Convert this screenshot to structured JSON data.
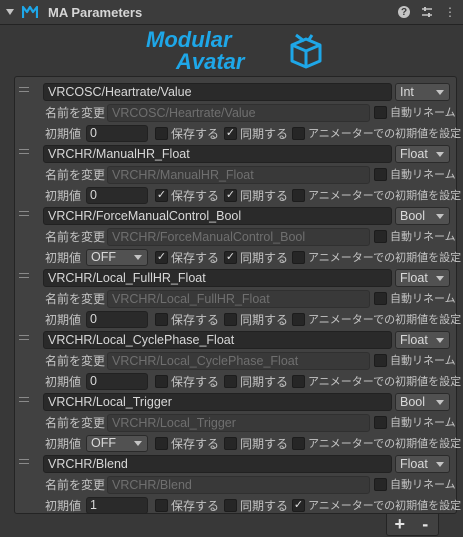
{
  "window": {
    "title": "MA Parameters"
  },
  "labels": {
    "rename": "名前を変更",
    "auto_rename": "自動リネーム",
    "initial_value": "初期値",
    "saved": "保存する",
    "synced": "同期する",
    "animator_default": "アニメーターでの初期値を設定"
  },
  "params": [
    {
      "name": "VRCOSC/Heartrate/Value",
      "type": "Int",
      "rename_placeholder": "VRCOSC/Heartrate/Value",
      "auto_rename": false,
      "default_value": "0",
      "default_is_dropdown": false,
      "saved": false,
      "synced": true,
      "animator_default": false
    },
    {
      "name": "VRCHR/ManualHR_Float",
      "type": "Float",
      "rename_placeholder": "VRCHR/ManualHR_Float",
      "auto_rename": false,
      "default_value": "0",
      "default_is_dropdown": false,
      "saved": true,
      "synced": true,
      "animator_default": false
    },
    {
      "name": "VRCHR/ForceManualControl_Bool",
      "type": "Bool",
      "rename_placeholder": "VRCHR/ForceManualControl_Bool",
      "auto_rename": false,
      "default_value": "OFF",
      "default_is_dropdown": true,
      "saved": true,
      "synced": true,
      "animator_default": false
    },
    {
      "name": "VRCHR/Local_FullHR_Float",
      "type": "Float",
      "rename_placeholder": "VRCHR/Local_FullHR_Float",
      "auto_rename": false,
      "default_value": "0",
      "default_is_dropdown": false,
      "saved": false,
      "synced": false,
      "animator_default": false
    },
    {
      "name": "VRCHR/Local_CyclePhase_Float",
      "type": "Float",
      "rename_placeholder": "VRCHR/Local_CyclePhase_Float",
      "auto_rename": false,
      "default_value": "0",
      "default_is_dropdown": false,
      "saved": false,
      "synced": false,
      "animator_default": false
    },
    {
      "name": "VRCHR/Local_Trigger",
      "type": "Bool",
      "rename_placeholder": "VRCHR/Local_Trigger",
      "auto_rename": false,
      "default_value": "OFF",
      "default_is_dropdown": true,
      "saved": false,
      "synced": false,
      "animator_default": false
    },
    {
      "name": "VRCHR/Blend",
      "type": "Float",
      "rename_placeholder": "VRCHR/Blend",
      "auto_rename": false,
      "default_value": "1",
      "default_is_dropdown": false,
      "saved": false,
      "synced": false,
      "animator_default": true
    }
  ],
  "footer": {
    "add_label": "+",
    "remove_label": "-"
  },
  "logo": {
    "line1": "Modular",
    "line2": "Avatar"
  },
  "colors": {
    "accent": "#1ea7e8",
    "background": "#383838",
    "list_bg": "#414141"
  },
  "icons": [
    "help-icon",
    "settings-sliders-icon",
    "more-icon",
    "ma-icon"
  ]
}
